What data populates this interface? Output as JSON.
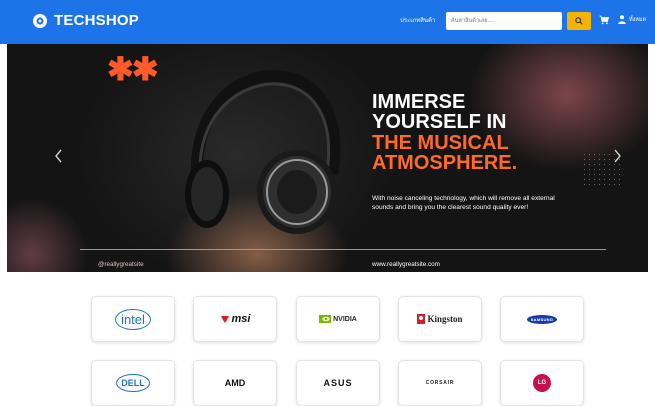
{
  "navbar": {
    "brand": "TECHSHOP",
    "nav_link": "ประเภทสินค้า",
    "search_placeholder": "ค้นหาสินค้าเลย.....",
    "user_label": "ทั้งหมด",
    "bg_color": "#1d73e8",
    "search_button_color": "#f5b301"
  },
  "hero": {
    "line1": "IMMERSE",
    "line2": "YOURSELF IN",
    "line3": "THE MUSICAL",
    "line4": "ATMOSPHERE.",
    "description": "With noise canceling technology, which will remove all external sounds and bring you the clearest sound quality ever!",
    "handle": "@reallygreatsite",
    "website": "www.reallygreatsite.com",
    "asterisks": "✱✱",
    "accent_color": "#ff6a2b"
  },
  "brands": {
    "row1": [
      "intel",
      "msi",
      "NVIDIA",
      "Kingston",
      "SAMSUNG"
    ],
    "row2": [
      "DELL",
      "AMD",
      "ASUS",
      "CORSAIR",
      "LG"
    ]
  }
}
